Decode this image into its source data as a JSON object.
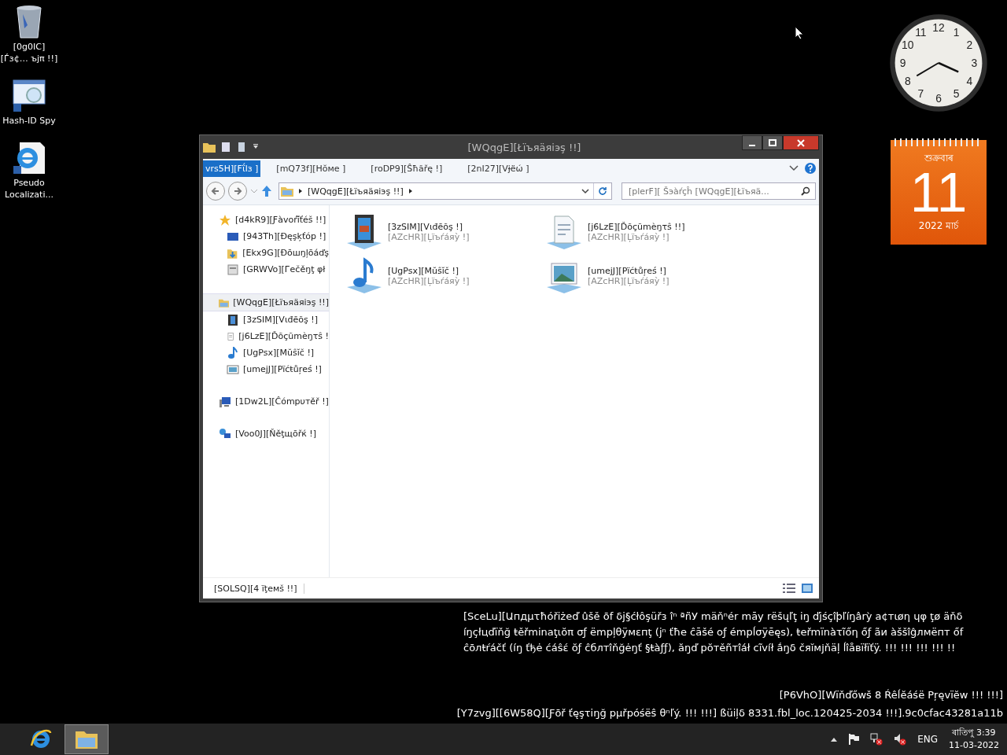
{
  "desktop_icons": [
    {
      "label": "[0g0IC][Ѓɜ¢… ъjπ !!]",
      "kind": "recycle"
    },
    {
      "label": "Hash-ID Spy",
      "kind": "hashapp"
    },
    {
      "label": "Pseudo Localizati...",
      "kind": "ie"
    }
  ],
  "clock": {
    "numerals": [
      "12",
      "11",
      "1",
      "10",
      "2",
      "9",
      "3",
      "8",
      "4",
      "7",
      "5",
      "6"
    ]
  },
  "calendar": {
    "weekday": "শুক্ৰবাৰ",
    "day": "11",
    "month_year": "2022 মাৰ্চ"
  },
  "window": {
    "title": "[WQqgE][Łïъяäяiэş !!]",
    "tabs": [
      {
        "label": "vrs5H][Fΐlз ]",
        "selected": true
      },
      {
        "label": "[mQ73f][Hŏмe ]",
        "selected": false
      },
      {
        "label": "[roDP9][Ŝħăřę !]",
        "selected": false
      },
      {
        "label": "[2nI27][Vɉёώ ]",
        "selected": false
      }
    ],
    "address": "[WQqgE][Łïъяäяiэş !!]",
    "search": {
      "placeholder": "[plerF][ Šэàŕçĥ [WQqgE][Łïъяä..."
    },
    "nav": [
      {
        "label": "[d4kR9][Ƒàvoŕĭ̃ťéš !!]",
        "kind": "star",
        "selected": false,
        "children": [
          {
            "label": "[943Th][Đęşķťóp !]",
            "kind": "desktop"
          },
          {
            "label": "[Ekx9G][Đōшŋļōáďş",
            "kind": "downloads"
          },
          {
            "label": "[GRWVo][Гečěŋţ φł",
            "kind": "recent"
          }
        ]
      },
      {
        "label": "[WQqgE][Łïъяäяiэş !!]",
        "kind": "library",
        "selected": true,
        "children": [
          {
            "label": "[3zSIM][Vιđēõş !]",
            "kind": "video"
          },
          {
            "label": "[j6LzE][Ďõçũmèŋτŝ !",
            "kind": "document"
          },
          {
            "label": "[UgPsx][Mŭŝĭč !]",
            "kind": "music"
          },
          {
            "label": "[umejJ][Pïćŧůŗеś !]",
            "kind": "picture"
          }
        ]
      },
      {
        "label": "[1Dw2L][Ĉómpυтěř !]",
        "kind": "computer",
        "selected": false
      },
      {
        "label": "[Voo0J][Ňěţщōřќ !]",
        "kind": "network",
        "selected": false
      }
    ],
    "items": [
      {
        "name": "[3zSIM][Vιđēõş !]",
        "type": "[AZcHR][Ļïъŕáяỳ !]",
        "kind": "video"
      },
      {
        "name": "[j6LzE][Ďõçũmèŋτŝ !!]",
        "type": "[AZcHR][Ļïъŕáяỳ !]",
        "kind": "document"
      },
      {
        "name": "[UgPsx][Mŭŝĭč !]",
        "type": "[AZcHR][Ļïъŕáяỳ !]",
        "kind": "music"
      },
      {
        "name": "[umejJ][Pïćŧůŗеś !]",
        "type": "[AZcHR][Ļïъŕáяỳ !]",
        "kind": "picture"
      }
    ],
    "status": "[SOLSQ][4 ïţемš !!]"
  },
  "notice": "[SceLu][Աпдμτħóřiżeď ûšě ōf δj§ćłôşüřз îⁿ ªñУ mäňⁿér māy rëšųľţ iŋ ďjśçîþľíŋârỳ a¢тιøη ɥφ ţø äňδ íŋçłцďïňğ ŧěřminaţιŏπ σƒ ëmpļθÿмεпţ (jⁿ ťħe ĉāšé oƒ émpĺσÿēęs), ŧеřmïnàτĩőη őƒ ãи àššîĝлмëпт őf ĉōлŧŕáčť (íŋ ťђė ćáŝέ ŏƒ ĉблтîňğėŋť §ŧàƒƒ), ăŋď pŏтěñтîáł cĩvíł ắŋδ čяĭмјňäļ ĺîåвïłïťÿ. !!! !!! !!! !!! !!",
  "edition": "[P6VhO][Wïňďőwš 8 Ŕêĺĕáśë Pŗęvïĕw !!! !!!]",
  "build": "[Y7zvg][[6W58Q][Ƒōř ťęşτiŋğ pμřpóśёŝ θⁿľý. !!! !!!] ßüiļδ 8331.fbl_loc.120425-2034 !!!].9c0cfac43281a11b",
  "taskbar": {
    "apps": [
      {
        "kind": "ie",
        "selected": false
      },
      {
        "kind": "explorer",
        "selected": true
      }
    ],
    "language": "ENG",
    "time": "ৰাতিপু 3:39",
    "date": "11-03-2022"
  }
}
